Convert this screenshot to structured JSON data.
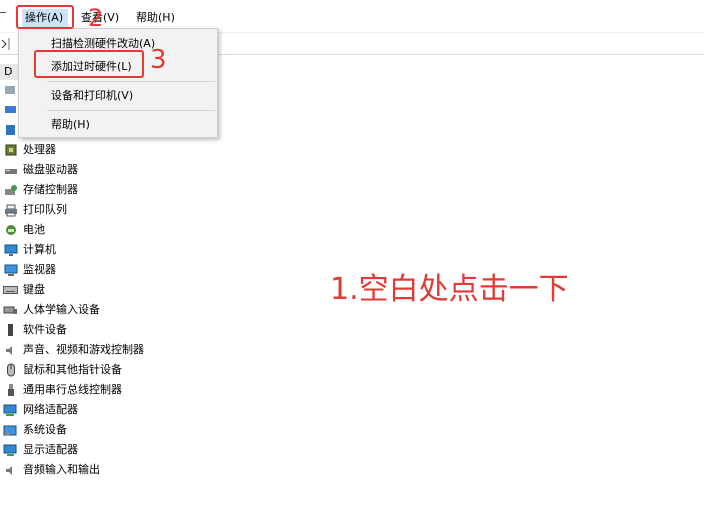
{
  "menubar": {
    "action": "操作(A)",
    "view": "查看(V)",
    "help": "帮助(H)"
  },
  "tree": {
    "root_prefix": "D",
    "items": [
      {
        "label": "处理器",
        "icon": "processor-icon"
      },
      {
        "label": "磁盘驱动器",
        "icon": "disk-drive-icon"
      },
      {
        "label": "存储控制器",
        "icon": "storage-controller-icon"
      },
      {
        "label": "打印队列",
        "icon": "printer-icon"
      },
      {
        "label": "电池",
        "icon": "battery-icon"
      },
      {
        "label": "计算机",
        "icon": "computer-icon"
      },
      {
        "label": "监视器",
        "icon": "monitor-icon"
      },
      {
        "label": "键盘",
        "icon": "keyboard-icon"
      },
      {
        "label": "人体学输入设备",
        "icon": "hid-icon"
      },
      {
        "label": "软件设备",
        "icon": "software-device-icon"
      },
      {
        "label": "声音、视频和游戏控制器",
        "icon": "sound-icon"
      },
      {
        "label": "鼠标和其他指针设备",
        "icon": "mouse-icon"
      },
      {
        "label": "通用串行总线控制器",
        "icon": "usb-icon"
      },
      {
        "label": "网络适配器",
        "icon": "network-adapter-icon"
      },
      {
        "label": "系统设备",
        "icon": "system-device-icon"
      },
      {
        "label": "显示适配器",
        "icon": "display-adapter-icon"
      },
      {
        "label": "音频输入和输出",
        "icon": "audio-io-icon"
      }
    ]
  },
  "dropdown": {
    "scan": "扫描检测硬件改动(A)",
    "add_legacy": "添加过时硬件(L)",
    "devices_printers": "设备和打印机(V)",
    "help": "帮助(H)"
  },
  "annotations": {
    "step1": "1.空白处点击一下",
    "step2": "2",
    "step3": "3",
    "color": "#e53935"
  }
}
